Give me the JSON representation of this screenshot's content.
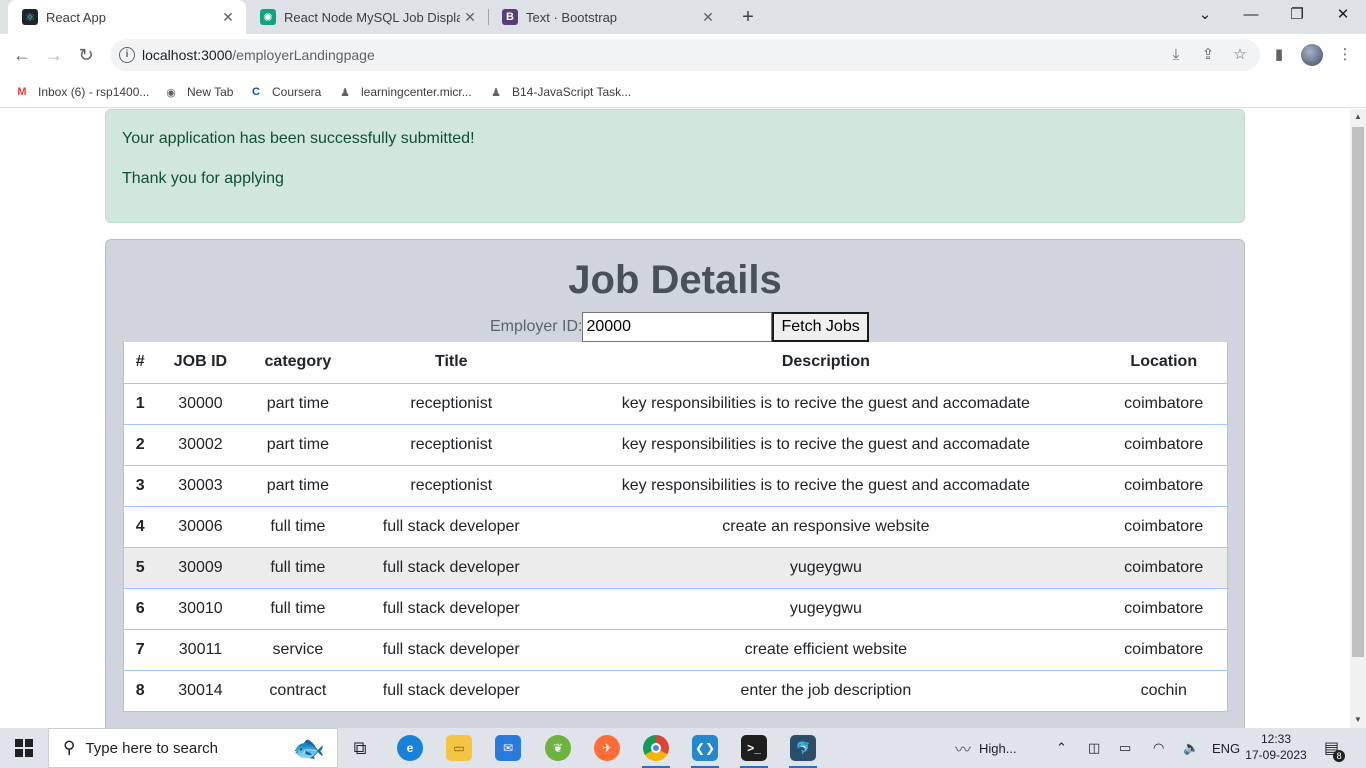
{
  "browser": {
    "tabs": [
      {
        "title": "React App",
        "favicon": "react-icon",
        "active": true
      },
      {
        "title": "React Node MySQL Job Display",
        "favicon": "openai-icon",
        "active": false
      },
      {
        "title": "Text · Bootstrap",
        "favicon": "bootstrap-icon",
        "active": false
      }
    ],
    "url_host": "localhost:3000",
    "url_path": "/employerLandingpage",
    "bookmarks": [
      {
        "label": "Inbox (6) - rsp1400...",
        "icon": "gmail-icon"
      },
      {
        "label": "New Tab",
        "icon": "globe-icon"
      },
      {
        "label": "Coursera",
        "icon": "coursera-icon"
      },
      {
        "label": "learningcenter.micr...",
        "icon": "person-icon"
      },
      {
        "label": "B14-JavaScript Task...",
        "icon": "person-icon"
      }
    ]
  },
  "alert": {
    "line1": "Your application has been successfully submitted!",
    "line2": "Thank you for applying"
  },
  "job_details": {
    "heading": "Job Details",
    "employer_label": "Employer ID:",
    "employer_value": "20000",
    "fetch_label": "Fetch Jobs",
    "columns": [
      "#",
      "JOB ID",
      "category",
      "Title",
      "Description",
      "Location"
    ],
    "rows": [
      {
        "n": "1",
        "id": "30000",
        "category": "part time",
        "title": "receptionist",
        "description": "key responsibilities is to recive the guest and accomadate",
        "location": "coimbatore"
      },
      {
        "n": "2",
        "id": "30002",
        "category": "part time",
        "title": "receptionist",
        "description": "key responsibilities is to recive the guest and accomadate",
        "location": "coimbatore"
      },
      {
        "n": "3",
        "id": "30003",
        "category": "part time",
        "title": "receptionist",
        "description": "key responsibilities is to recive the guest and accomadate",
        "location": "coimbatore"
      },
      {
        "n": "4",
        "id": "30006",
        "category": "full time",
        "title": "full stack developer",
        "description": "create an responsive website",
        "location": "coimbatore"
      },
      {
        "n": "5",
        "id": "30009",
        "category": "full time",
        "title": "full stack developer",
        "description": "yugeygwu",
        "location": "coimbatore"
      },
      {
        "n": "6",
        "id": "30010",
        "category": "full time",
        "title": "full stack developer",
        "description": "yugeygwu",
        "location": "coimbatore"
      },
      {
        "n": "7",
        "id": "30011",
        "category": "service",
        "title": "full stack developer",
        "description": "create efficient website",
        "location": "coimbatore"
      },
      {
        "n": "8",
        "id": "30014",
        "category": "contract",
        "title": "full stack developer",
        "description": "enter the job description",
        "location": "cochin"
      }
    ]
  },
  "taskbar": {
    "search_placeholder": "Type here to search",
    "weather": "High...",
    "language": "ENG",
    "time": "12:33",
    "date": "17-09-2023",
    "notifications": "8"
  },
  "colors": {
    "alert_bg": "#d1e7dd",
    "alert_text": "#0f5132",
    "card_bg": "#d0d4dc",
    "table_border": "#9ec5fe",
    "hover_row": "#ececec"
  }
}
